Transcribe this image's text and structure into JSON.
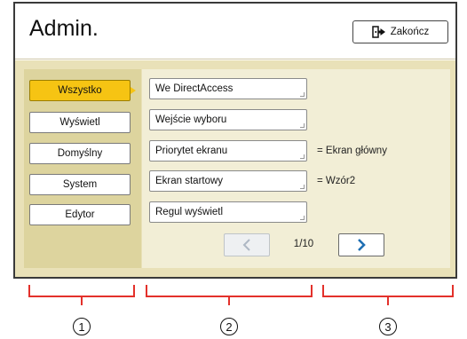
{
  "header": {
    "title": "Admin.",
    "exit_label": "Zakończ"
  },
  "categories": [
    {
      "label": "Wszystko",
      "active": true
    },
    {
      "label": "Wyświetl",
      "active": false
    },
    {
      "label": "Domyślny",
      "active": false
    },
    {
      "label": "System",
      "active": false
    },
    {
      "label": "Edytor",
      "active": false
    }
  ],
  "items": [
    {
      "label": "We DirectAccess",
      "value": ""
    },
    {
      "label": "Wejście wyboru",
      "value": ""
    },
    {
      "label": "Priorytet ekranu",
      "value": "= Ekran główny"
    },
    {
      "label": "Ekran startowy",
      "value": "= Wzór2"
    },
    {
      "label": "Regul wyświetl",
      "value": ""
    }
  ],
  "pagination": {
    "page_text": "1/10",
    "prev_enabled": false
  },
  "callouts": [
    "1",
    "2",
    "3"
  ],
  "colors": {
    "active_category": "#f6c413",
    "panel_background": "#e9e1b8",
    "callout_red": "#e3312b"
  }
}
